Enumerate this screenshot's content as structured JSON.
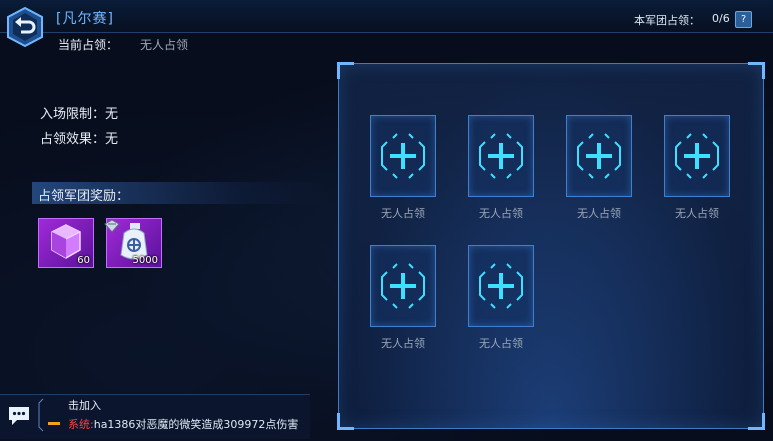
{
  "header": {
    "title": "[凡尔赛]",
    "current_label": "当前占领：",
    "current_value": "无人占领",
    "legion_label": "本军团占领：",
    "legion_value": "0/6",
    "help_label": "?"
  },
  "info": {
    "entry_limit": "入场限制：无",
    "occupy_effect": "占领效果：无"
  },
  "reward": {
    "header": "占领军团奖励：",
    "items": [
      {
        "icon": "purple-crystal-icon",
        "count": "60"
      },
      {
        "icon": "money-bag-icon",
        "count": "5000"
      }
    ]
  },
  "slots": [
    {
      "label": "无人占领"
    },
    {
      "label": "无人占领"
    },
    {
      "label": "无人占领"
    },
    {
      "label": "无人占领"
    },
    {
      "label": "无人占领"
    },
    {
      "label": "无人占领"
    }
  ],
  "chat": {
    "line1": "击加入",
    "system_tag": "系统:",
    "message": "ha1386对恶魔的微笑造成309972点伤害"
  },
  "colors": {
    "accent": "#6fb7ff",
    "slot_plus": "#3de0ff",
    "system_red": "#ff4040",
    "reward_purple": "#a02ad8"
  }
}
